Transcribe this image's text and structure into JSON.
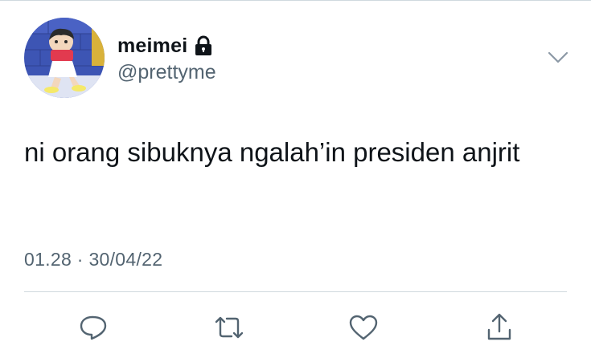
{
  "tweet": {
    "display_name": "meimei",
    "handle": "@prettyme",
    "text": "ni orang sibuknya ngalah’in presiden anjrit",
    "time": "01.28",
    "separator": "·",
    "date": "30/04/22"
  },
  "icons": {
    "lock": "lock-icon",
    "more": "chevron-down-icon",
    "reply": "reply-icon",
    "retweet": "retweet-icon",
    "like": "heart-icon",
    "share": "share-icon"
  },
  "colors": {
    "text_primary": "#0f1419",
    "text_secondary": "#536471",
    "divider": "#cfd9de"
  }
}
